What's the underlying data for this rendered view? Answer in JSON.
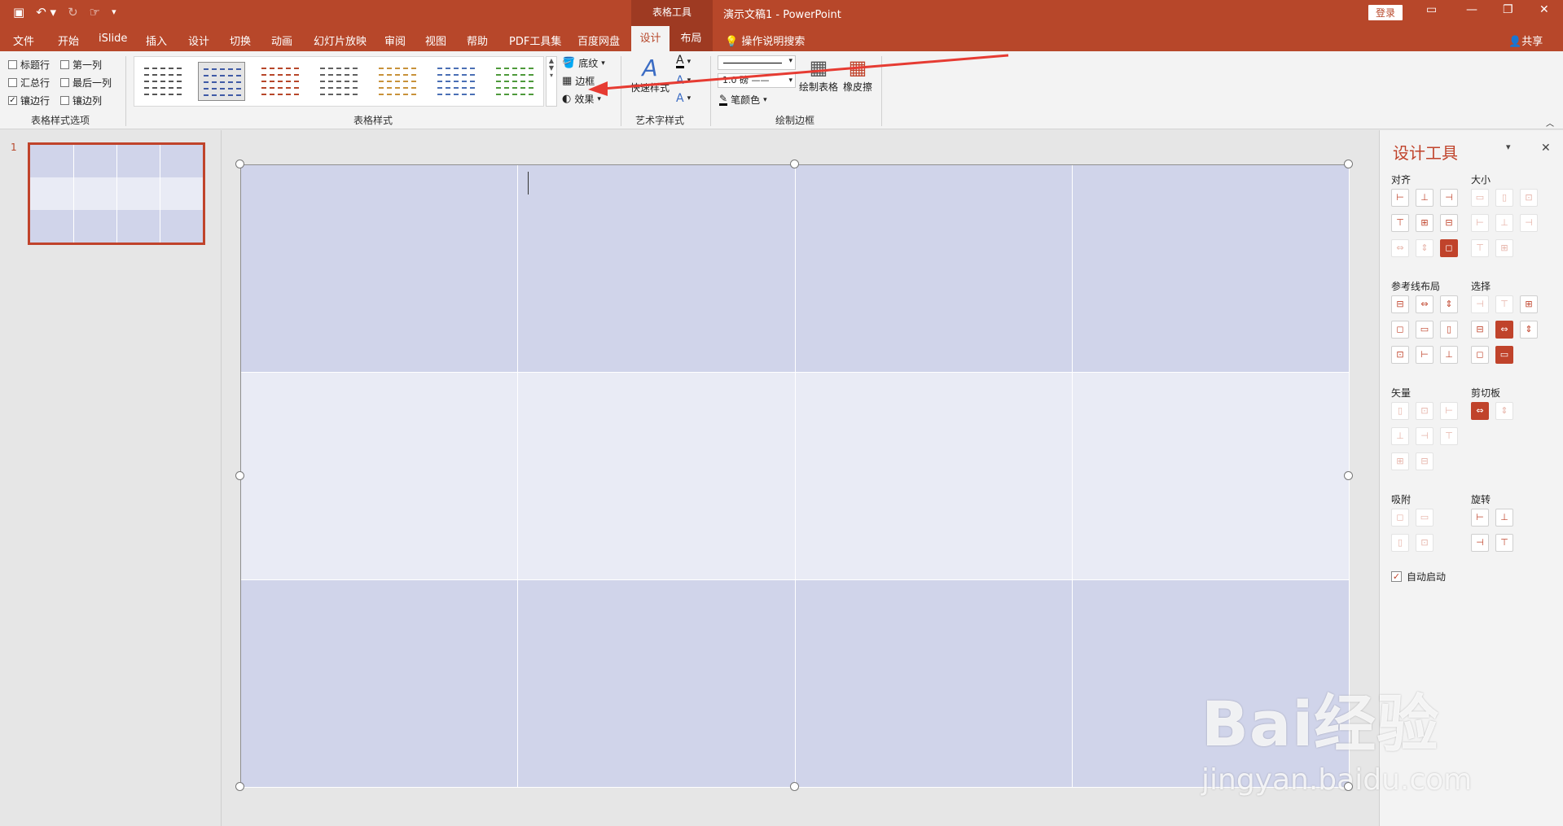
{
  "titlebar": {
    "qat_icons": [
      "save-icon",
      "undo-icon",
      "redo-icon",
      "touch-mode-icon",
      "customize-icon"
    ],
    "context_group": "表格工具",
    "doc_title": "演示文稿1  -  PowerPoint",
    "login": "登录",
    "window_controls": [
      "ribbon-display-icon",
      "minimize-icon",
      "restore-icon",
      "close-icon"
    ]
  },
  "tabs": [
    "文件",
    "开始",
    "iSlide",
    "插入",
    "设计",
    "切换",
    "动画",
    "幻灯片放映",
    "审阅",
    "视图",
    "帮助",
    "PDF工具集",
    "百度网盘"
  ],
  "active_tab": "设计",
  "context_tab": "布局",
  "tell_me": "操作说明搜索",
  "share": "共享",
  "ribbon": {
    "options": {
      "label": "表格样式选项",
      "items": [
        {
          "label": "标题行",
          "checked": false
        },
        {
          "label": "第一列",
          "checked": false
        },
        {
          "label": "汇总行",
          "checked": false
        },
        {
          "label": "最后一列",
          "checked": false
        },
        {
          "label": "镶边行",
          "checked": true
        },
        {
          "label": "镶边列",
          "checked": false
        }
      ]
    },
    "styles": {
      "label": "表格样式",
      "swatch_colors": [
        "#555555",
        "#3f5aa6",
        "#b7472a",
        "#606060",
        "#c8923a",
        "#4a6fb5",
        "#4e9a3b"
      ],
      "selected_index": 1
    },
    "shading": "底纹",
    "borders": "边框",
    "effects": "效果",
    "wordart": {
      "label": "艺术字样式",
      "quick_styles": "快速样式"
    },
    "draw": {
      "label": "绘制边框",
      "pen_weight": "1.0 磅",
      "pen_color": "笔颜色",
      "draw_table": "绘制表格",
      "eraser": "橡皮擦"
    }
  },
  "slide": {
    "number": "1"
  },
  "table": {
    "rows": 3,
    "cols": 4,
    "band_color": "#d0d4ea",
    "alt_color": "#e9ebf5"
  },
  "sidepane": {
    "title": "设计工具",
    "sections": {
      "align": "对齐",
      "size": "大小",
      "guides": "参考线布局",
      "select": "选择",
      "vector": "矢量",
      "clipboard": "剪切板",
      "snap": "吸附",
      "rotate": "旋转"
    },
    "autostart": {
      "label": "自动启动",
      "checked": true
    }
  },
  "watermark": {
    "brand": "Bai经验",
    "url": "jingyan.baidu.com"
  }
}
